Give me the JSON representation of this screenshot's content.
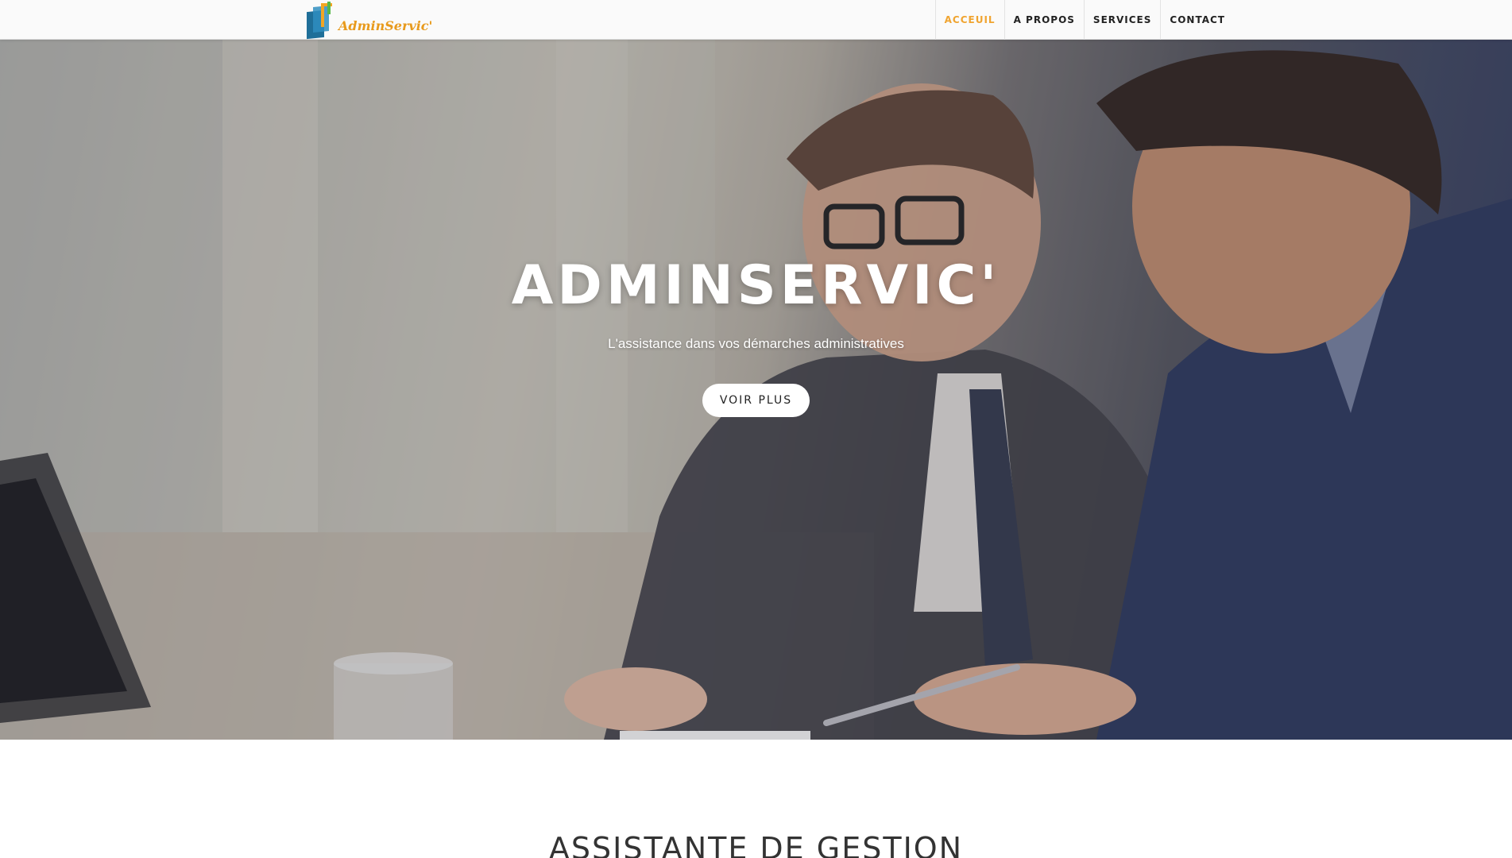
{
  "navbar": {
    "logo_text": "AdminServic'",
    "items": [
      {
        "label": "ACCEUIL",
        "active": true
      },
      {
        "label": "A PROPOS",
        "active": false
      },
      {
        "label": "SERVICES",
        "active": false
      },
      {
        "label": "CONTACT",
        "active": false
      }
    ],
    "active_color": "#f0a430"
  },
  "hero": {
    "title": "ADMINSERVIC'",
    "subtitle": "L'assistance dans vos démarches administratives",
    "button_label": "VOIR PLUS"
  },
  "section": {
    "heading": "ASSISTANTE DE GESTION"
  }
}
